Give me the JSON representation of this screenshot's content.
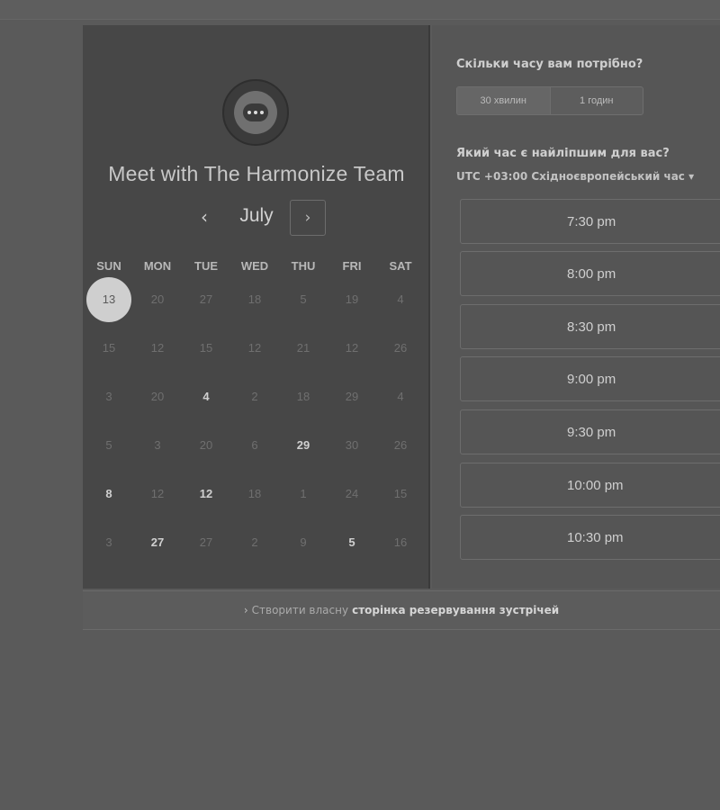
{
  "left": {
    "title": "Meet with The Harmonize Team",
    "month": "July",
    "prev_icon": "chevron-left-icon",
    "next_icon": "chevron-right-icon",
    "weekdays": [
      "SUN",
      "MON",
      "TUE",
      "WED",
      "THU",
      "FRI",
      "SAT"
    ],
    "weeks": [
      [
        {
          "d": "13",
          "s": "selected"
        },
        {
          "d": "20",
          "s": "dim"
        },
        {
          "d": "27",
          "s": "dim"
        },
        {
          "d": "18",
          "s": "dim"
        },
        {
          "d": "5",
          "s": "dim"
        },
        {
          "d": "19",
          "s": "dim"
        },
        {
          "d": "4",
          "s": "dim"
        }
      ],
      [
        {
          "d": "15",
          "s": "dim"
        },
        {
          "d": "12",
          "s": "dim"
        },
        {
          "d": "15",
          "s": "dim"
        },
        {
          "d": "12",
          "s": "dim"
        },
        {
          "d": "21",
          "s": "dim"
        },
        {
          "d": "12",
          "s": "dim"
        },
        {
          "d": "26",
          "s": "dim"
        }
      ],
      [
        {
          "d": "3",
          "s": "dim"
        },
        {
          "d": "20",
          "s": "dim"
        },
        {
          "d": "4",
          "s": "avail"
        },
        {
          "d": "2",
          "s": "dim"
        },
        {
          "d": "18",
          "s": "dim"
        },
        {
          "d": "29",
          "s": "dim"
        },
        {
          "d": "4",
          "s": "dim"
        }
      ],
      [
        {
          "d": "5",
          "s": "dim"
        },
        {
          "d": "3",
          "s": "dim"
        },
        {
          "d": "20",
          "s": "dim"
        },
        {
          "d": "6",
          "s": "dim"
        },
        {
          "d": "29",
          "s": "avail"
        },
        {
          "d": "30",
          "s": "dim"
        },
        {
          "d": "26",
          "s": "dim"
        }
      ],
      [
        {
          "d": "8",
          "s": "avail"
        },
        {
          "d": "12",
          "s": "dim"
        },
        {
          "d": "12",
          "s": "avail"
        },
        {
          "d": "18",
          "s": "dim"
        },
        {
          "d": "1",
          "s": "dim"
        },
        {
          "d": "24",
          "s": "dim"
        },
        {
          "d": "15",
          "s": "dim"
        }
      ],
      [
        {
          "d": "3",
          "s": "dim"
        },
        {
          "d": "27",
          "s": "avail"
        },
        {
          "d": "27",
          "s": "dim"
        },
        {
          "d": "2",
          "s": "dim"
        },
        {
          "d": "9",
          "s": "dim"
        },
        {
          "d": "5",
          "s": "avail"
        },
        {
          "d": "16",
          "s": "dim"
        }
      ]
    ]
  },
  "right": {
    "duration_question": "Скільки часу вам потрібно?",
    "durations": [
      {
        "label": "30 хвилин",
        "active": true
      },
      {
        "label": "1 годин",
        "active": false
      }
    ],
    "time_question": "Який час є найліпшим для вас?",
    "timezone": "UTC +03:00 Східноєвропейський час",
    "timezone_icon": "caret-down-icon",
    "slots": [
      "7:30 pm",
      "8:00 pm",
      "8:30 pm",
      "9:00 pm",
      "9:30 pm",
      "10:00 pm",
      "10:30 pm"
    ]
  },
  "footer": {
    "icon": "chevron-right-icon",
    "prefix": "Створити власну",
    "link": "сторінка резервування зустрічей"
  }
}
